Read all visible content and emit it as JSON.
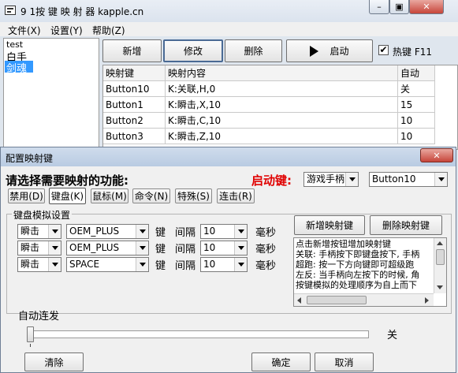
{
  "main": {
    "title": "9 1按 键 映 射 器 kapple.cn",
    "window_buttons": [
      "–",
      "▣",
      "✕"
    ],
    "menu": [
      "文件(X)",
      "设置(Y)",
      "帮助(Z)"
    ],
    "profiles": [
      "test",
      "白手",
      "剑魂"
    ],
    "toolbar": {
      "add": "新增",
      "edit": "修改",
      "delete": "删除",
      "start": "启动",
      "hotkey": "热键 F11"
    },
    "table": {
      "headers": [
        "映射键",
        "映射内容",
        "自动"
      ],
      "rows": [
        [
          "Button10",
          "K:关联,H,0",
          "关"
        ],
        [
          "Button1",
          "K:瞬击,X,10",
          "15"
        ],
        [
          "Button2",
          "K:瞬击,C,10",
          "10"
        ],
        [
          "Button3",
          "K:瞬击,Z,10",
          "10"
        ]
      ]
    }
  },
  "dialog": {
    "title": "配置映射键",
    "close": "✕",
    "prompt": "请选择需要映射的功能:",
    "start_key_label": "启动键:",
    "device": "游戏手柄",
    "button": "Button10",
    "tabs": [
      "禁用(D)",
      "键盘(K)",
      "鼠标(M)",
      "命令(N)",
      "特殊(S)",
      "连击(R)"
    ],
    "group_title": "键盘模拟设置",
    "rows": [
      {
        "mode": "瞬击",
        "key": "OEM_PLUS",
        "interval": "10"
      },
      {
        "mode": "瞬击",
        "key": "OEM_PLUS",
        "interval": "10"
      },
      {
        "mode": "瞬击",
        "key": "SPACE",
        "interval": "10"
      }
    ],
    "word_key": "键",
    "word_interval": "间隔",
    "word_ms": "毫秒",
    "add_mapping": "新增映射键",
    "delete_mapping": "删除映射键",
    "help_lines": [
      "点击新增按钮增加映射键",
      "关联: 手柄按下即键盘按下, 手柄",
      "超跑: 按一下方向键即可超级跑",
      "左反: 当手柄向左按下的时候, 角",
      "按键模拟的处理顺序为自上而下"
    ],
    "auto_fire_label": "自动连发",
    "auto_fire_level": 0,
    "auto_fire_value": "关",
    "clear": "清除",
    "ok": "确定",
    "cancel": "取消"
  },
  "colors": {
    "selection": "#3399ff",
    "accent_red": "#e00000"
  }
}
